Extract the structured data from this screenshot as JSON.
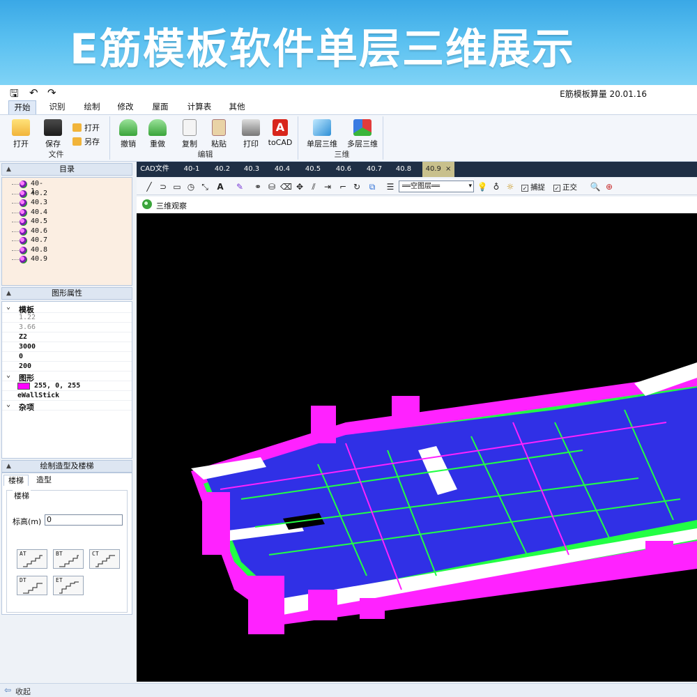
{
  "banner": {
    "text": "E筋模板软件单层三维展示"
  },
  "app": {
    "title": "E筋模板算量 20.01.16"
  },
  "quick_access": [
    {
      "icon": "save-icon",
      "glyph": "🖫"
    },
    {
      "icon": "undo-icon",
      "glyph": "↶"
    },
    {
      "icon": "redo-icon",
      "glyph": "↷"
    }
  ],
  "menu_tabs": [
    "开始",
    "识别",
    "绘制",
    "修改",
    "屋面",
    "计算表",
    "其他"
  ],
  "active_menu_tab": "开始",
  "ribbon": {
    "file_group": {
      "label": "文件",
      "open_big": "打开",
      "save": "保存",
      "open_small": "打开",
      "save_as": "另存"
    },
    "edit_group": {
      "label": "编辑",
      "undo": "撤销",
      "redo": "重做",
      "copy": "复制",
      "paste": "粘贴",
      "print": "打印",
      "tocad": "toCAD"
    },
    "three_d_group": {
      "label": "三维",
      "single": "单层三维",
      "multi": "多层三维"
    }
  },
  "directory": {
    "title": "目录",
    "items": [
      "40-1",
      "40.2",
      "40.3",
      "40.4",
      "40.5",
      "40.6",
      "40.7",
      "40.8",
      "40.9"
    ]
  },
  "properties": {
    "title": "图形属性",
    "cat_template": "模板",
    "values": [
      "1.22",
      "3.66",
      "Z2",
      "3000",
      "0",
      "200"
    ],
    "cat_shape": "图形",
    "color": "255, 0, 255",
    "color_hex": "#ff00ff",
    "class_name": "eWallStick",
    "cat_misc": "杂项"
  },
  "stairs_panel": {
    "title": "绘制造型及楼梯",
    "tab_stairs": "楼梯",
    "tab_shape": "造型",
    "group_label": "楼梯",
    "elevation_label": "标高(m)",
    "elevation_value": "0",
    "types": [
      "AT",
      "BT",
      "CT",
      "DT",
      "ET"
    ]
  },
  "cad_tabs": {
    "label": "CAD文件",
    "tabs": [
      "40-1",
      "40.2",
      "40.3",
      "40.4",
      "40.5",
      "40.6",
      "40.7",
      "40.8",
      "40.9"
    ],
    "active": "40.9",
    "close": "×"
  },
  "toolbar": {
    "layer_value": "══空图层══",
    "snap_label": "捕捉",
    "ortho_label": "正交"
  },
  "view": {
    "title": "三维观察"
  },
  "status": {
    "collapse": "收起"
  },
  "colors": {
    "slab": "#3030e6",
    "beam": "#ff22ff",
    "edge": "#22ff44",
    "wall": "#ffffff"
  }
}
